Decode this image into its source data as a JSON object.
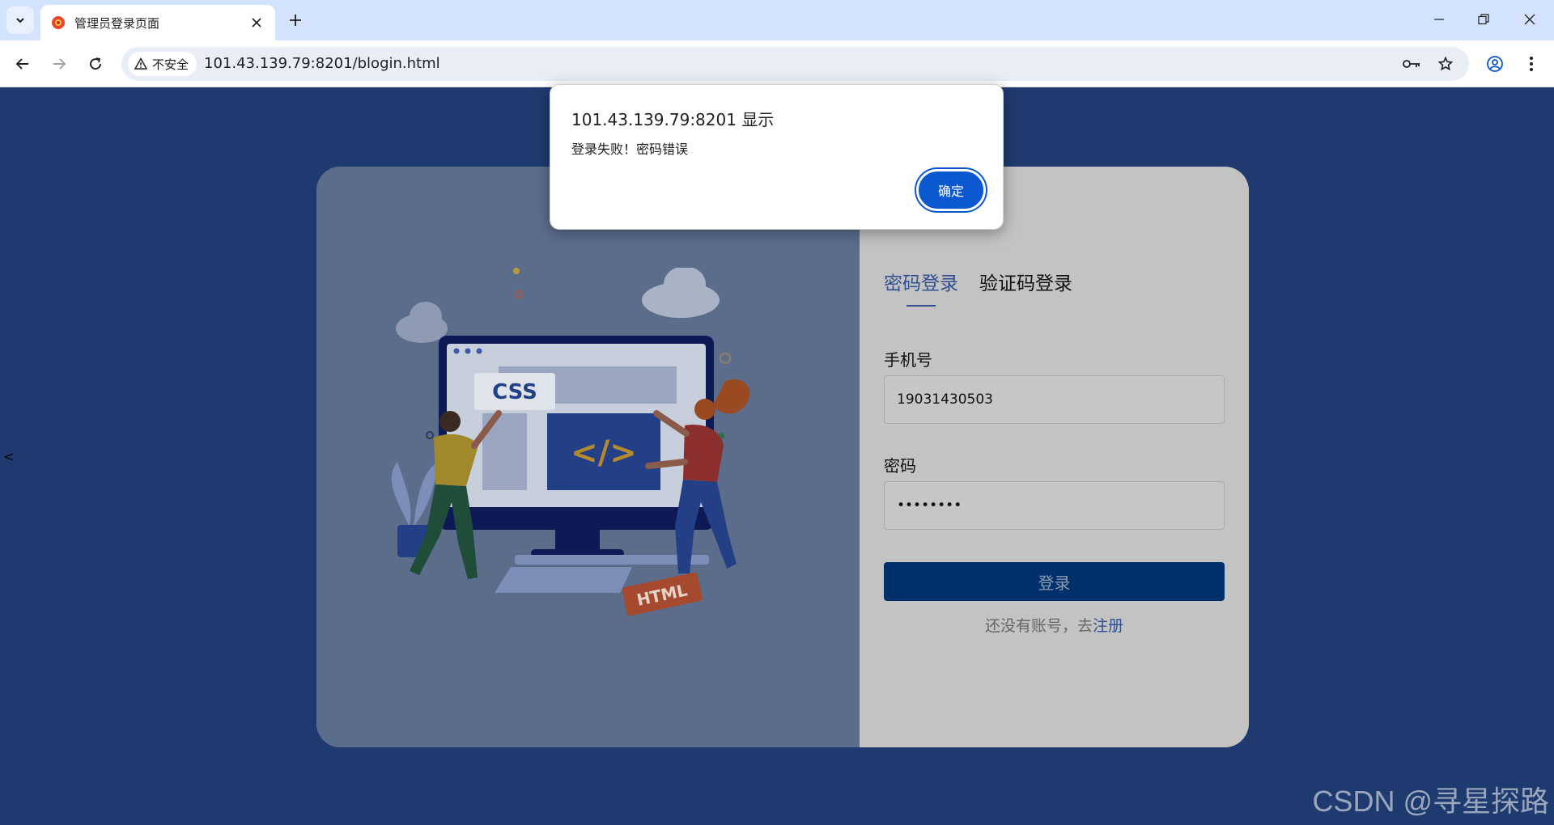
{
  "browser": {
    "tab_title": "管理员登录页面",
    "security_label": "不安全",
    "url": "101.43.139.79:8201/blogin.html"
  },
  "login": {
    "tabs": [
      {
        "label": "密码登录",
        "active": true
      },
      {
        "label": "验证码登录",
        "active": false
      }
    ],
    "phone_label": "手机号",
    "phone_value": "19031430503",
    "password_label": "密码",
    "password_value": "••••••••",
    "submit_label": "登录",
    "register_prefix": "还没有账号，去",
    "register_link": "注册"
  },
  "illustration": {
    "css_label": "CSS",
    "code_label": "</>",
    "html_label": "HTML"
  },
  "dialog": {
    "title": "101.43.139.79:8201 显示",
    "message": "登录失败！密码错误",
    "ok_label": "确定"
  },
  "page": {
    "side_glyph": "<"
  },
  "watermark": "CSDN @寻星探路",
  "colors": {
    "page_bg": "#1e3a6e",
    "accent": "#0b57d0",
    "tab_active": "#2f4f8f",
    "login_button": "#00306b"
  }
}
